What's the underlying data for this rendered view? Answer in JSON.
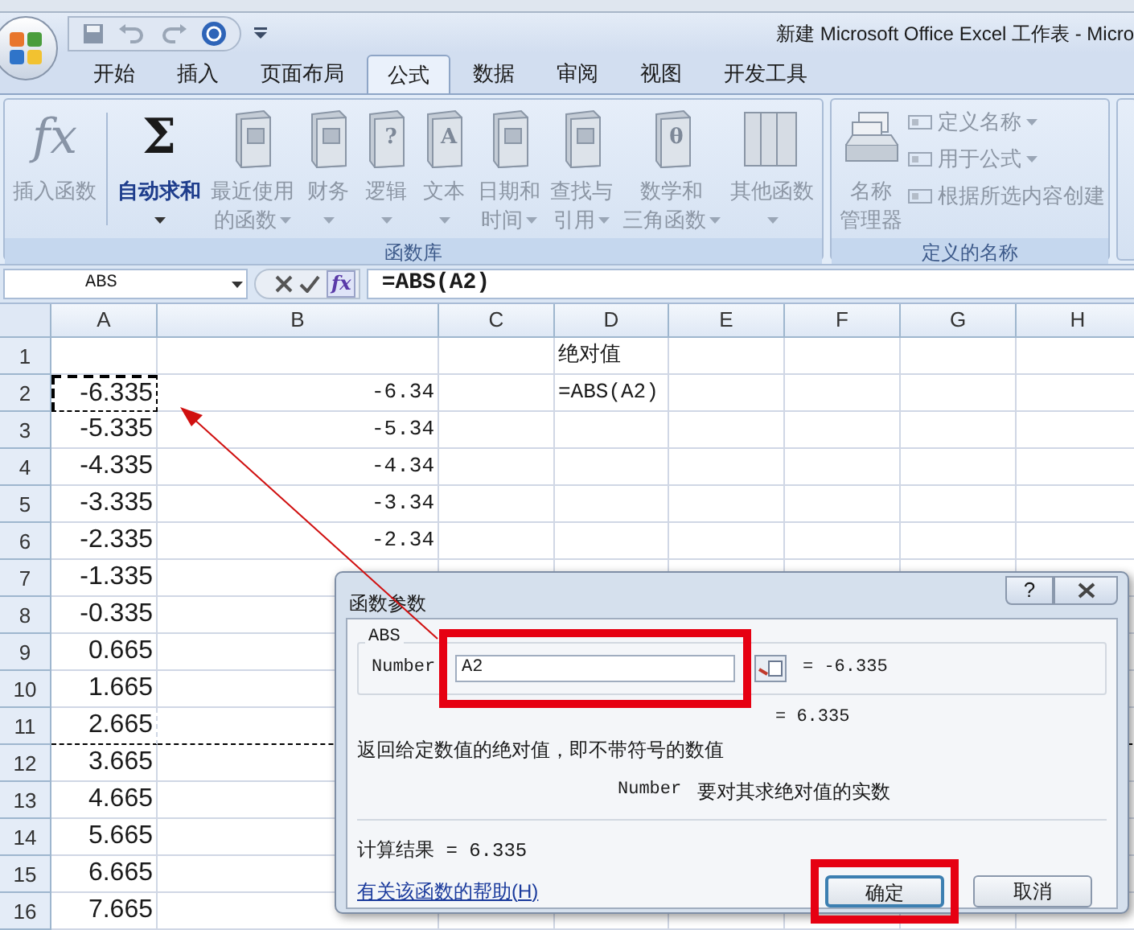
{
  "window": {
    "title": "新建 Microsoft Office Excel 工作表 - Micro"
  },
  "ribbon_tabs": [
    {
      "label": "开始",
      "selected": false
    },
    {
      "label": "插入",
      "selected": false
    },
    {
      "label": "页面布局",
      "selected": false
    },
    {
      "label": "公式",
      "selected": true
    },
    {
      "label": "数据",
      "selected": false
    },
    {
      "label": "审阅",
      "selected": false
    },
    {
      "label": "视图",
      "selected": false
    },
    {
      "label": "开发工具",
      "selected": false
    }
  ],
  "ribbon": {
    "groups": [
      {
        "label": "函数库",
        "buttons": [
          {
            "kind": "glyph",
            "glyph": "fx",
            "lines": [
              "插入函数"
            ],
            "dropdown": false,
            "disabled": true
          },
          {
            "kind": "glyph",
            "glyph": "Σ",
            "lines": [
              "自动求和"
            ],
            "dropdown": true,
            "disabled": false
          },
          {
            "kind": "book",
            "lines": [
              "最近使用",
              "的函数"
            ],
            "dropdown": true,
            "disabled": true
          },
          {
            "kind": "book",
            "lines": [
              "财务"
            ],
            "dropdown": true,
            "disabled": true
          },
          {
            "kind": "book",
            "glyph": "?",
            "lines": [
              "逻辑"
            ],
            "dropdown": true,
            "disabled": true
          },
          {
            "kind": "book",
            "glyph": "A",
            "lines": [
              "文本"
            ],
            "dropdown": true,
            "disabled": true
          },
          {
            "kind": "book",
            "lines": [
              "日期和",
              "时间"
            ],
            "dropdown": true,
            "disabled": true
          },
          {
            "kind": "book",
            "lines": [
              "查找与",
              "引用"
            ],
            "dropdown": true,
            "disabled": true
          },
          {
            "kind": "book",
            "glyph": "θ",
            "lines": [
              "数学和",
              "三角函数"
            ],
            "dropdown": true,
            "disabled": true
          },
          {
            "kind": "books",
            "lines": [
              "其他函数"
            ],
            "dropdown": true,
            "disabled": true
          }
        ]
      },
      {
        "label": "定义的名称",
        "buttons": [
          {
            "kind": "cards",
            "lines": [
              "名称",
              "管理器"
            ],
            "dropdown": false,
            "disabled": true
          }
        ],
        "small_buttons": [
          {
            "label": "定义名称",
            "dropdown": true,
            "disabled": true
          },
          {
            "label": "用于公式",
            "dropdown": true,
            "disabled": true
          },
          {
            "label": "根据所选内容创建",
            "dropdown": false,
            "disabled": true
          }
        ]
      }
    ]
  },
  "formula_bar": {
    "name_box": "ABS",
    "fx": "fx",
    "formula": "=ABS(A2)"
  },
  "sheet": {
    "columns": [
      "A",
      "B",
      "C",
      "D",
      "E",
      "F",
      "G",
      "H"
    ],
    "rows": [
      {
        "number": "1",
        "cells": [
          "",
          "",
          "",
          "绝对值"
        ]
      },
      {
        "number": "2",
        "marquee": true,
        "cells": [
          "-6.335",
          "-6.34",
          "",
          "=ABS(A2)"
        ]
      },
      {
        "number": "3",
        "cells": [
          "-5.335",
          "-5.34"
        ]
      },
      {
        "number": "4",
        "cells": [
          "-4.335",
          "-4.34"
        ]
      },
      {
        "number": "5",
        "cells": [
          "-3.335",
          "-3.34"
        ]
      },
      {
        "number": "6",
        "cells": [
          "-2.335",
          "-2.34"
        ]
      },
      {
        "number": "7",
        "cells": [
          "-1.335"
        ]
      },
      {
        "number": "8",
        "cells": [
          "-0.335"
        ]
      },
      {
        "number": "9",
        "cells": [
          "0.665"
        ]
      },
      {
        "number": "10",
        "cells": [
          "1.665"
        ]
      },
      {
        "number": "11",
        "page_break_after": true,
        "cells": [
          "2.665"
        ]
      },
      {
        "number": "12",
        "cells": [
          "3.665"
        ]
      },
      {
        "number": "13",
        "cells": [
          "4.665"
        ]
      },
      {
        "number": "14",
        "cells": [
          "5.665"
        ]
      },
      {
        "number": "15",
        "cells": [
          "6.665"
        ]
      },
      {
        "number": "16",
        "cells": [
          "7.665"
        ]
      }
    ]
  },
  "callout_arrow": true,
  "dialog": {
    "title": "函数参数",
    "help": "?",
    "function_name": "ABS",
    "argument": {
      "label": "Number",
      "value": "A2",
      "result": "= -6.335",
      "highlighted": true
    },
    "result": "= 6.335",
    "description": "返回给定数值的绝对值，即不带符号的数值",
    "argument_help": {
      "name": "Number",
      "text": "要对其求绝对值的实数"
    },
    "formula_result": "计算结果 = 6.335",
    "help_link": "有关该函数的帮助(H)",
    "buttons": [
      {
        "label": "确定",
        "default": true,
        "highlighted": true
      },
      {
        "label": "取消",
        "default": false,
        "highlighted": false
      }
    ]
  }
}
